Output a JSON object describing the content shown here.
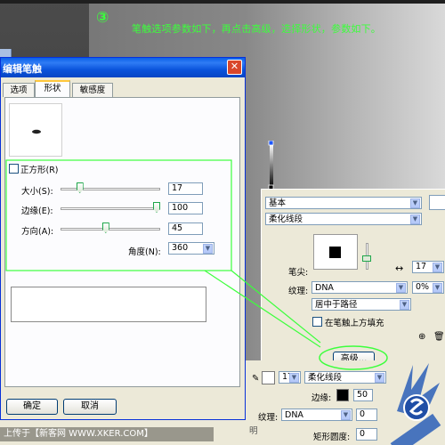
{
  "annotation": {
    "step_number": "③",
    "instruction": "笔触选项参数如下，再点击高级，选择形状，参数如下。"
  },
  "dialog": {
    "title": "编辑笔触",
    "close_glyph": "✕",
    "tabs": [
      {
        "label": "选项"
      },
      {
        "label": "形状"
      },
      {
        "label": "敏感度"
      }
    ],
    "active_tab": 1,
    "square_checkbox_label": "正方形(R)",
    "square_checked": false,
    "sliders": [
      {
        "label": "大小(S):",
        "value": "17",
        "level": 0.17
      },
      {
        "label": "边缘(E):",
        "value": "100",
        "level": 1.0
      },
      {
        "label": "方向(A):",
        "value": "45",
        "level": 0.45
      }
    ],
    "angle_label": "角度(N):",
    "angle_value": "360",
    "ok_button": "确定",
    "cancel_button": "取消"
  },
  "prop_panel": {
    "category": "基本",
    "brush_type": "柔化线段",
    "tip_label": "笔尖:",
    "tip_size": "17",
    "texture_label": "纹理:",
    "texture_value": "DNA",
    "texture_percent": "0%",
    "placement": "居中于路径",
    "fill_over_label": "在笔触上方填充",
    "fill_over_checked": false,
    "advanced_button": "高级..."
  },
  "bottom_toolbar": {
    "stroke_size": "17",
    "stroke_type": "柔化线段",
    "edge_label": "边缘:",
    "edge_value": "50",
    "texture_label": "纹理:",
    "texture_value": "DNA",
    "texture_percent": "0",
    "corner_label": "矩形圆度:",
    "corner_value": "0",
    "partial_text": "明"
  },
  "watermark": "上传于【新客网 WWW.XKER.COM】",
  "colors": {
    "highlight": "#3cff3c",
    "titlebar": "#0b54dc",
    "dialog_bg": "#ece9d8"
  }
}
